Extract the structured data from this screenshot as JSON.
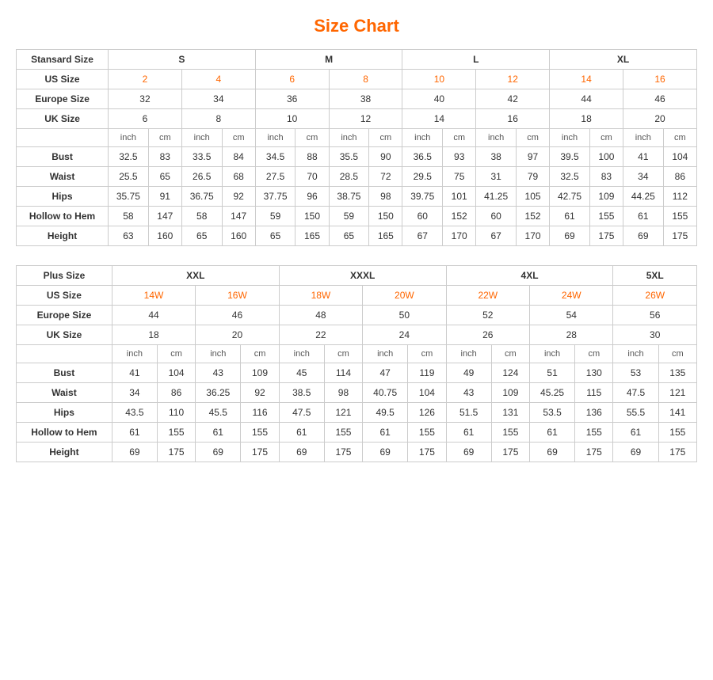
{
  "title": "Size Chart",
  "standard": {
    "label": "Stansard Size",
    "groups": [
      "S",
      "M",
      "L",
      "XL"
    ],
    "group_cols": [
      2,
      2,
      2,
      2
    ],
    "us_size_label": "US Size",
    "us_sizes": [
      "2",
      "4",
      "6",
      "8",
      "10",
      "12",
      "14",
      "16"
    ],
    "europe_size_label": "Europe Size",
    "europe_sizes": [
      "32",
      "34",
      "36",
      "38",
      "40",
      "42",
      "44",
      "46"
    ],
    "uk_size_label": "UK Size",
    "uk_sizes": [
      "6",
      "8",
      "10",
      "12",
      "14",
      "16",
      "18",
      "20"
    ],
    "sub_headers": [
      "inch",
      "cm",
      "inch",
      "cm",
      "inch",
      "cm",
      "inch",
      "cm",
      "inch",
      "cm",
      "inch",
      "cm",
      "inch",
      "cm",
      "inch",
      "cm"
    ],
    "measurements": [
      {
        "label": "Bust",
        "values": [
          "32.5",
          "83",
          "33.5",
          "84",
          "34.5",
          "88",
          "35.5",
          "90",
          "36.5",
          "93",
          "38",
          "97",
          "39.5",
          "100",
          "41",
          "104"
        ]
      },
      {
        "label": "Waist",
        "values": [
          "25.5",
          "65",
          "26.5",
          "68",
          "27.5",
          "70",
          "28.5",
          "72",
          "29.5",
          "75",
          "31",
          "79",
          "32.5",
          "83",
          "34",
          "86"
        ]
      },
      {
        "label": "Hips",
        "values": [
          "35.75",
          "91",
          "36.75",
          "92",
          "37.75",
          "96",
          "38.75",
          "98",
          "39.75",
          "101",
          "41.25",
          "105",
          "42.75",
          "109",
          "44.25",
          "112"
        ]
      },
      {
        "label": "Hollow to Hem",
        "values": [
          "58",
          "147",
          "58",
          "147",
          "59",
          "150",
          "59",
          "150",
          "60",
          "152",
          "60",
          "152",
          "61",
          "155",
          "61",
          "155"
        ]
      },
      {
        "label": "Height",
        "values": [
          "63",
          "160",
          "65",
          "160",
          "65",
          "165",
          "65",
          "165",
          "67",
          "170",
          "67",
          "170",
          "69",
          "175",
          "69",
          "175"
        ]
      }
    ]
  },
  "plus": {
    "label": "Plus Size",
    "groups": [
      "XXL",
      "XXXL",
      "4XL",
      "5XL"
    ],
    "group_cols": [
      2,
      2,
      2,
      1
    ],
    "us_size_label": "US Size",
    "us_sizes": [
      "14W",
      "16W",
      "18W",
      "20W",
      "22W",
      "24W",
      "26W"
    ],
    "europe_size_label": "Europe Size",
    "europe_sizes": [
      "44",
      "46",
      "48",
      "50",
      "52",
      "54",
      "56"
    ],
    "uk_size_label": "UK Size",
    "uk_sizes": [
      "18",
      "20",
      "22",
      "24",
      "26",
      "28",
      "30"
    ],
    "sub_headers": [
      "inch",
      "cm",
      "inch",
      "cm",
      "inch",
      "cm",
      "inch",
      "cm",
      "inch",
      "cm",
      "inch",
      "cm",
      "inch",
      "cm"
    ],
    "measurements": [
      {
        "label": "Bust",
        "values": [
          "41",
          "104",
          "43",
          "109",
          "45",
          "114",
          "47",
          "119",
          "49",
          "124",
          "51",
          "130",
          "53",
          "135"
        ]
      },
      {
        "label": "Waist",
        "values": [
          "34",
          "86",
          "36.25",
          "92",
          "38.5",
          "98",
          "40.75",
          "104",
          "43",
          "109",
          "45.25",
          "115",
          "47.5",
          "121"
        ]
      },
      {
        "label": "Hips",
        "values": [
          "43.5",
          "110",
          "45.5",
          "116",
          "47.5",
          "121",
          "49.5",
          "126",
          "51.5",
          "131",
          "53.5",
          "136",
          "55.5",
          "141"
        ]
      },
      {
        "label": "Hollow to Hem",
        "values": [
          "61",
          "155",
          "61",
          "155",
          "61",
          "155",
          "61",
          "155",
          "61",
          "155",
          "61",
          "155",
          "61",
          "155"
        ]
      },
      {
        "label": "Height",
        "values": [
          "69",
          "175",
          "69",
          "175",
          "69",
          "175",
          "69",
          "175",
          "69",
          "175",
          "69",
          "175",
          "69",
          "175"
        ]
      }
    ]
  }
}
